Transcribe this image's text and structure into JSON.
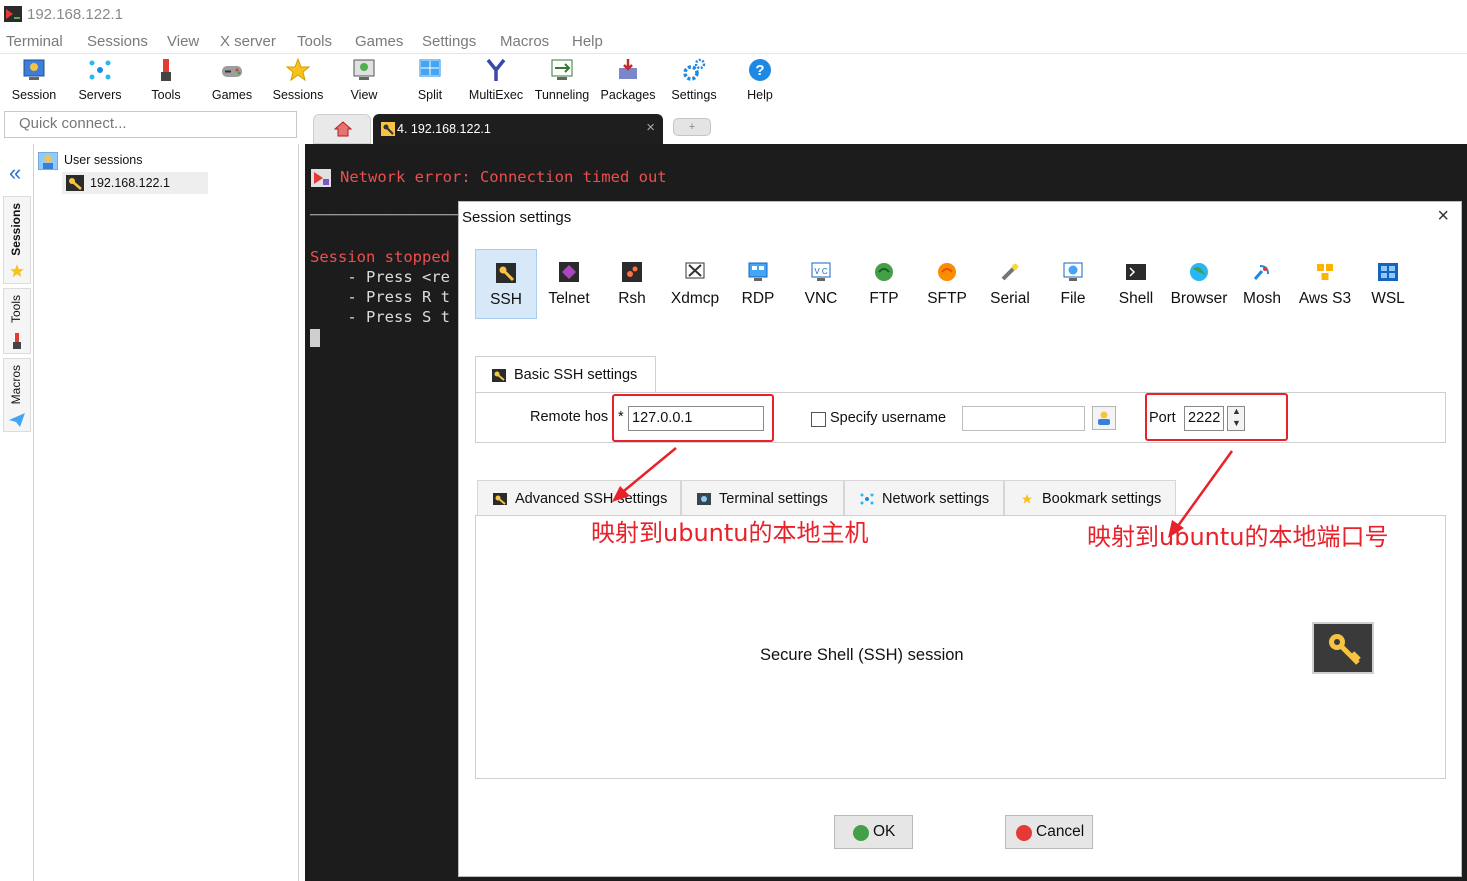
{
  "window": {
    "title": "192.168.122.1"
  },
  "menu": [
    "Terminal",
    "Sessions",
    "View",
    "X server",
    "Tools",
    "Games",
    "Settings",
    "Macros",
    "Help"
  ],
  "toolbar": [
    {
      "label": "Session",
      "icon": "session-icon"
    },
    {
      "label": "Servers",
      "icon": "servers-icon"
    },
    {
      "label": "Tools",
      "icon": "tools-icon"
    },
    {
      "label": "Games",
      "icon": "games-icon"
    },
    {
      "label": "Sessions",
      "icon": "star-icon"
    },
    {
      "label": "View",
      "icon": "view-icon"
    },
    {
      "label": "Split",
      "icon": "split-icon"
    },
    {
      "label": "MultiExec",
      "icon": "multiexec-icon"
    },
    {
      "label": "Tunneling",
      "icon": "tunneling-icon"
    },
    {
      "label": "Packages",
      "icon": "packages-icon"
    },
    {
      "label": "Settings",
      "icon": "gear-icon"
    },
    {
      "label": "Help",
      "icon": "help-icon"
    }
  ],
  "quick_connect": {
    "placeholder": "Quick connect..."
  },
  "tabs": {
    "session_tab": "4. 192.168.122.1",
    "close": "×",
    "new_tab": "+"
  },
  "sidebar": {
    "collapse": "«",
    "vtabs": [
      "Sessions",
      "Tools",
      "Macros"
    ]
  },
  "session_tree": {
    "root": "User sessions",
    "items": [
      "192.168.122.1"
    ]
  },
  "terminal": {
    "lines": [
      {
        "text": "Network error: Connection timed out",
        "color": "#ee4e4e"
      },
      {
        "text": "────────────────────────────────────",
        "color": "#dcdcdc"
      },
      {
        "text": "Session stopped",
        "color": "#ee4e4e"
      },
      {
        "text": "    - Press <re",
        "color": "#dcdcdc"
      },
      {
        "text": "    - Press R t",
        "color": "#dcdcdc"
      },
      {
        "text": "    - Press S t",
        "color": "#dcdcdc"
      }
    ]
  },
  "dialog": {
    "title": "Session settings",
    "close": "×",
    "session_types": [
      {
        "label": "SSH",
        "icon": "ssh-key-icon",
        "selected": true
      },
      {
        "label": "Telnet",
        "icon": "telnet-icon"
      },
      {
        "label": "Rsh",
        "icon": "rsh-icon"
      },
      {
        "label": "Xdmcp",
        "icon": "xdmcp-icon"
      },
      {
        "label": "RDP",
        "icon": "rdp-icon"
      },
      {
        "label": "VNC",
        "icon": "vnc-icon"
      },
      {
        "label": "FTP",
        "icon": "ftp-icon"
      },
      {
        "label": "SFTP",
        "icon": "sftp-icon"
      },
      {
        "label": "Serial",
        "icon": "serial-icon"
      },
      {
        "label": "File",
        "icon": "file-icon"
      },
      {
        "label": "Shell",
        "icon": "shell-icon"
      },
      {
        "label": "Browser",
        "icon": "browser-icon"
      },
      {
        "label": "Mosh",
        "icon": "mosh-icon"
      },
      {
        "label": "Aws S3",
        "icon": "aws-s3-icon"
      },
      {
        "label": "WSL",
        "icon": "wsl-icon"
      }
    ],
    "basic_tab": "Basic SSH settings",
    "remote_host_label": "Remote hos",
    "required_mark": "*",
    "remote_host_value": "127.0.0.1",
    "specify_username_label": "Specify username",
    "username_value": "",
    "port_label": "Port",
    "port_value": "2222",
    "subtabs": [
      "Advanced SSH settings",
      "Terminal settings",
      "Network settings",
      "Bookmark settings"
    ],
    "description": "Secure Shell (SSH) session",
    "ok_label": "OK",
    "cancel_label": "Cancel"
  },
  "annotations": {
    "host_note": "映射到ubuntu的本地主机",
    "port_note": "映射到ubuntu的本地端口号",
    "color": "#e8212a"
  }
}
